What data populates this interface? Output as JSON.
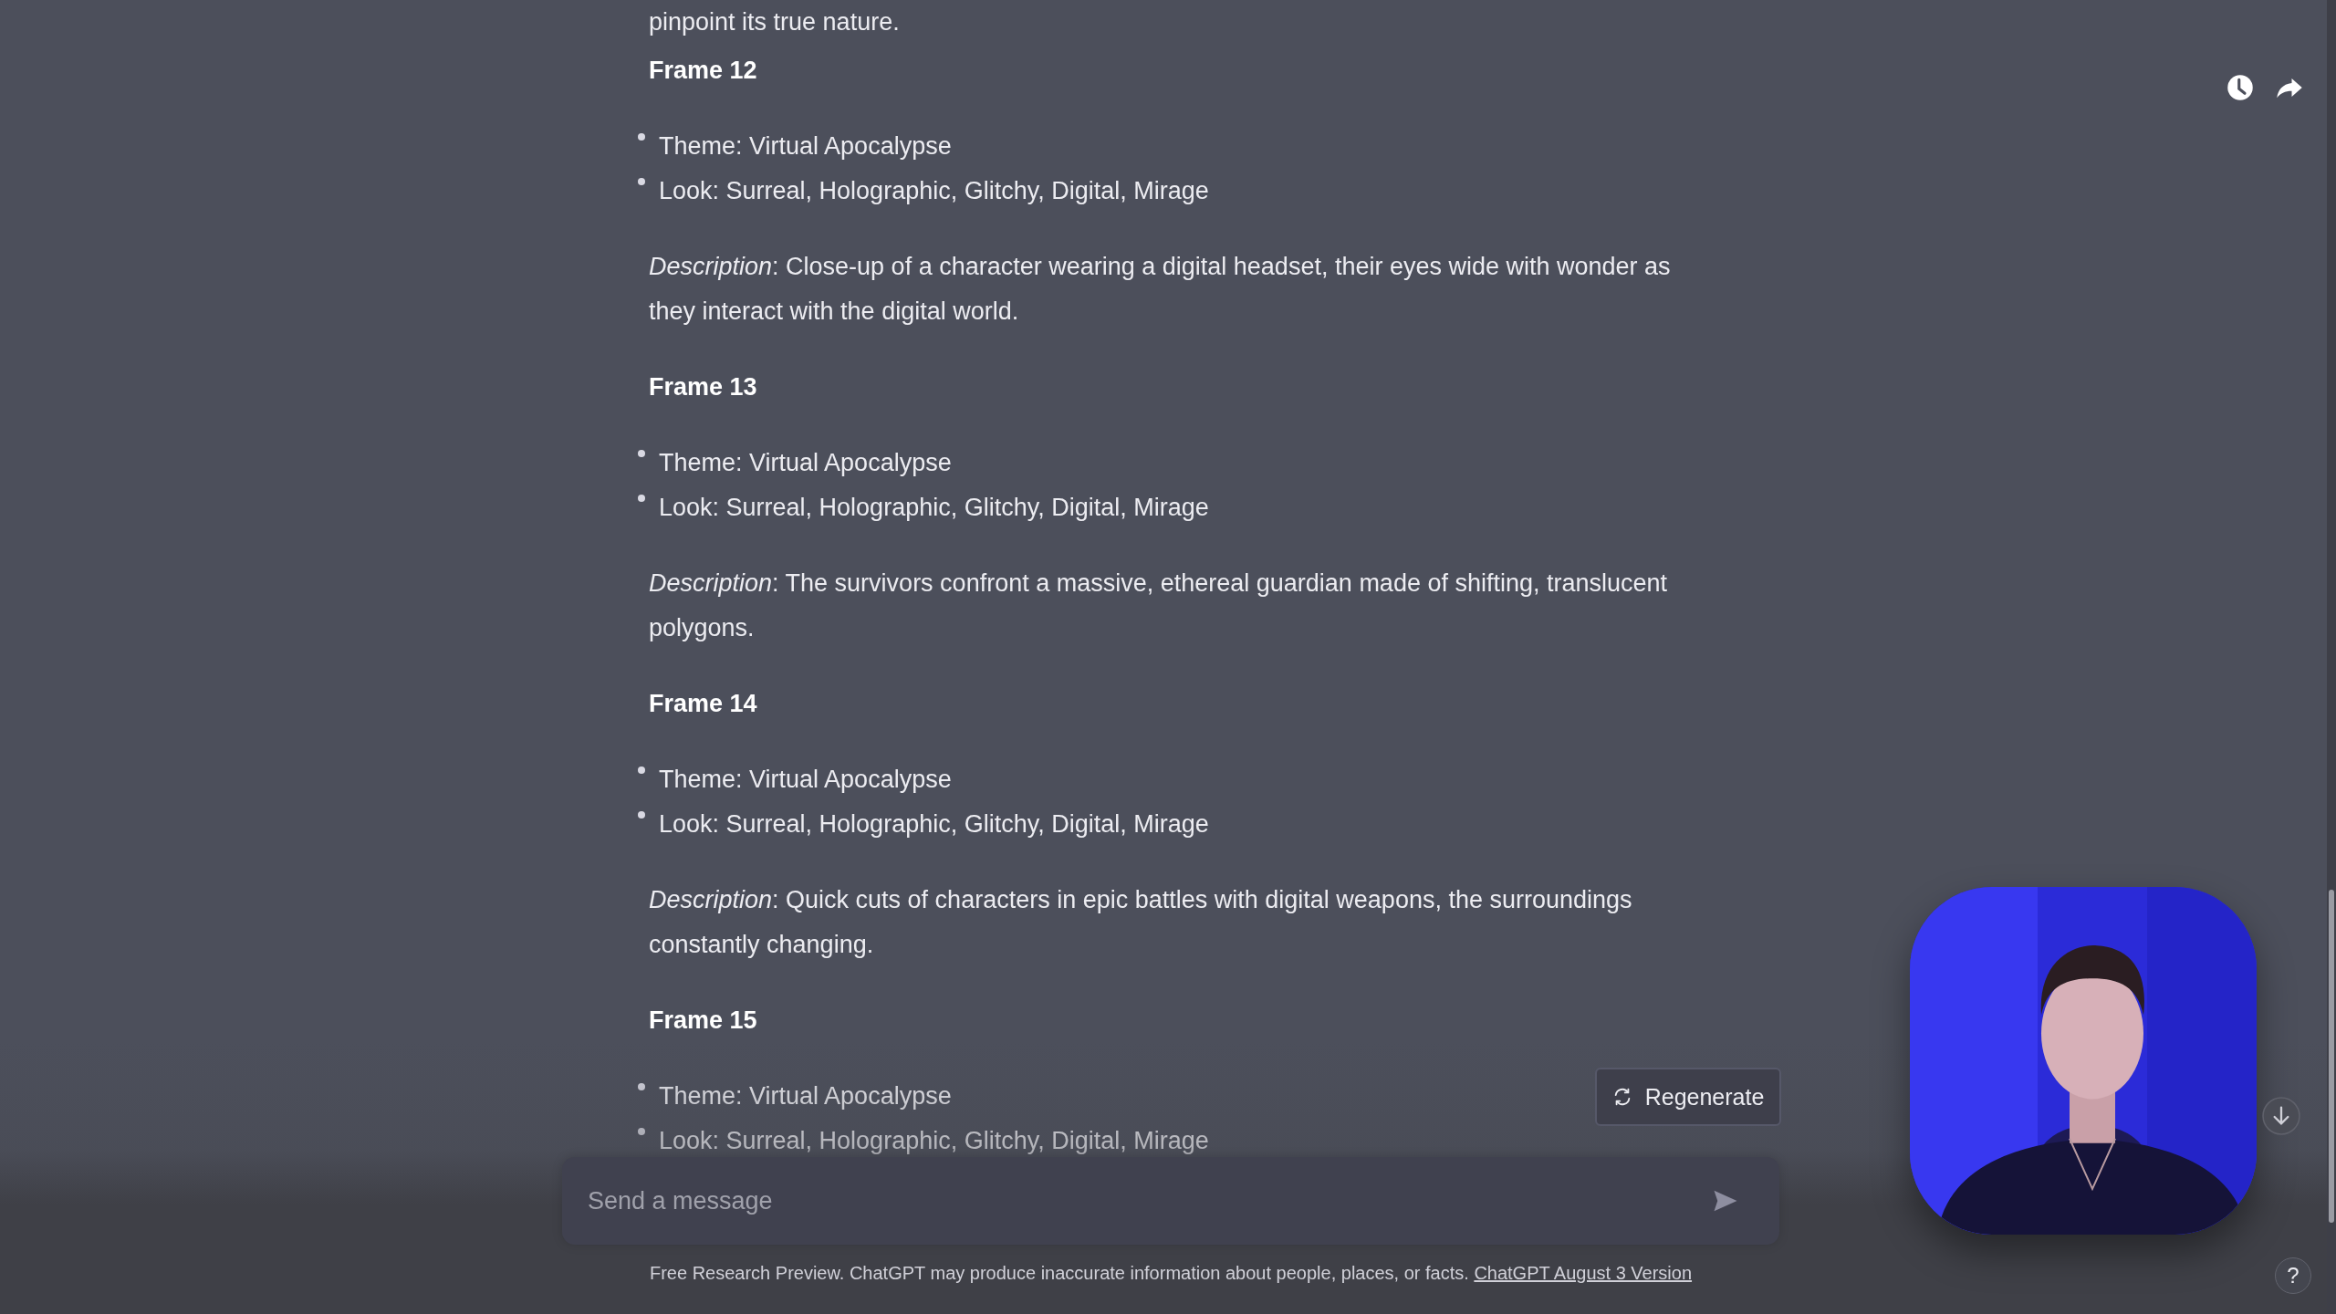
{
  "top_text": "pinpoint its true nature.",
  "frames": [
    {
      "heading": "Frame 12",
      "bullets": [
        "Theme: Virtual Apocalypse",
        "Look: Surreal, Holographic, Glitchy, Digital, Mirage"
      ],
      "description": "*Description*: Close-up of a character wearing a digital headset, their eyes wide with wonder as they interact with the digital world."
    },
    {
      "heading": "Frame 13",
      "bullets": [
        "Theme: Virtual Apocalypse",
        "Look: Surreal, Holographic, Glitchy, Digital, Mirage"
      ],
      "description": "*Description*: The survivors confront a massive, ethereal guardian made of shifting, translucent polygons."
    },
    {
      "heading": "Frame 14",
      "bullets": [
        "Theme: Virtual Apocalypse",
        "Look: Surreal, Holographic, Glitchy, Digital, Mirage"
      ],
      "description": "*Description*: Quick cuts of characters in epic battles with digital weapons, the surroundings constantly changing."
    },
    {
      "heading": "Frame 15",
      "bullets": [
        "Theme: Virtual Apocalypse",
        "Look: Surreal, Holographic, Glitchy, Digital, Mirage"
      ]
    }
  ],
  "regenerate": {
    "label": "Regenerate"
  },
  "composer": {
    "placeholder": "Send a message"
  },
  "footer": {
    "text": "Free Research Preview. ChatGPT may produce inaccurate information about people, places, or facts.",
    "link": "ChatGPT August 3 Version"
  },
  "help": {
    "label": "?"
  }
}
